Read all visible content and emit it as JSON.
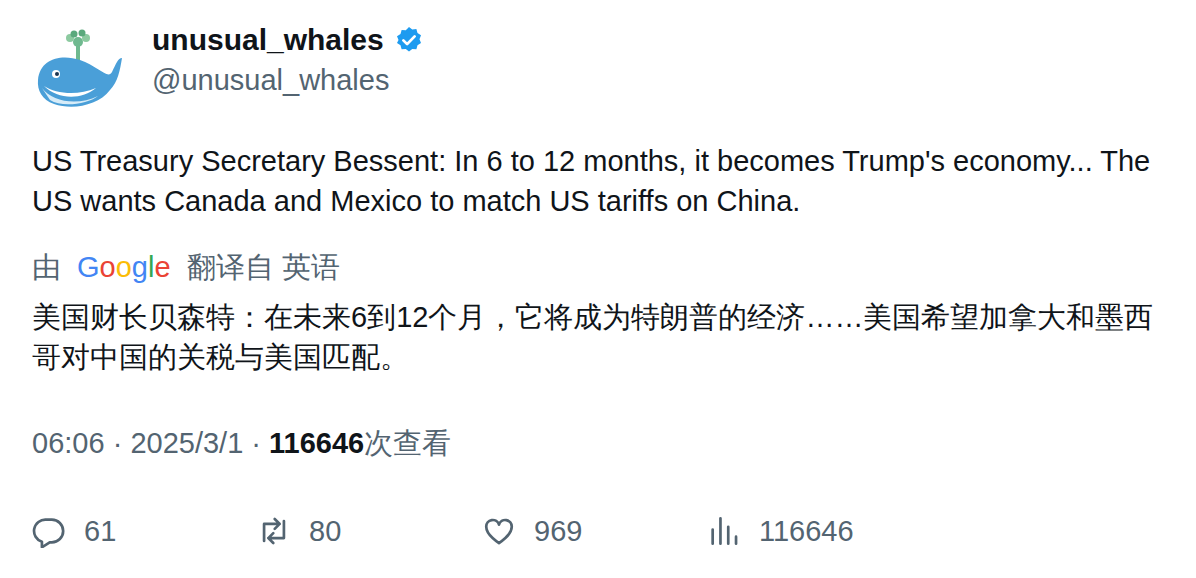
{
  "author": {
    "name": "unusual_whales",
    "handle": "@unusual_whales",
    "verified": true
  },
  "tweet": {
    "text": "US Treasury Secretary Bessent: In 6 to 12 months, it becomes Trump's economy... The US wants Canada and Mexico to match US tariffs on China.",
    "translation_label": {
      "prefix": "由",
      "provider": "Google",
      "suffix": "翻译自 英语"
    },
    "translation": "美国财长贝森特：在未来6到12个月，它将成为特朗普的经济……美国希望加拿大和墨西哥对中国的关税与美国匹配。"
  },
  "meta": {
    "time": "06:06",
    "separator": "·",
    "date": "2025/3/1",
    "views": "116646",
    "views_label": "次查看"
  },
  "actions": [
    {
      "kind": "reply",
      "count": "61"
    },
    {
      "kind": "retweet",
      "count": "80"
    },
    {
      "kind": "like",
      "count": "969"
    },
    {
      "kind": "views",
      "count": "116646"
    }
  ]
}
